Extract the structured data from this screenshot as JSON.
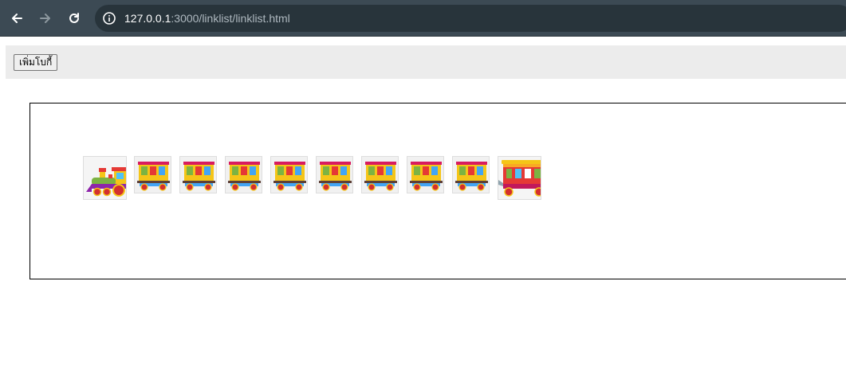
{
  "browser": {
    "url_host": "127.0.0.1",
    "url_path": ":3000/linklist/linklist.html",
    "icons": [
      "back-arrow-icon",
      "forward-arrow-icon",
      "reload-icon",
      "site-info-icon"
    ]
  },
  "toolbar": {
    "add_car_label": "เพิ่มโบกี้"
  },
  "train": {
    "locomotive": "locomotive-icon",
    "car_count": 8,
    "caboose": "caboose-icon"
  },
  "colors": {
    "chrome_bg": "#3c4a54",
    "url_bg": "#28343b",
    "toolbar_bg": "#ececec",
    "car_yellow": "#f5c518",
    "car_red": "#e53935",
    "wheel_red": "#d32f2f"
  }
}
